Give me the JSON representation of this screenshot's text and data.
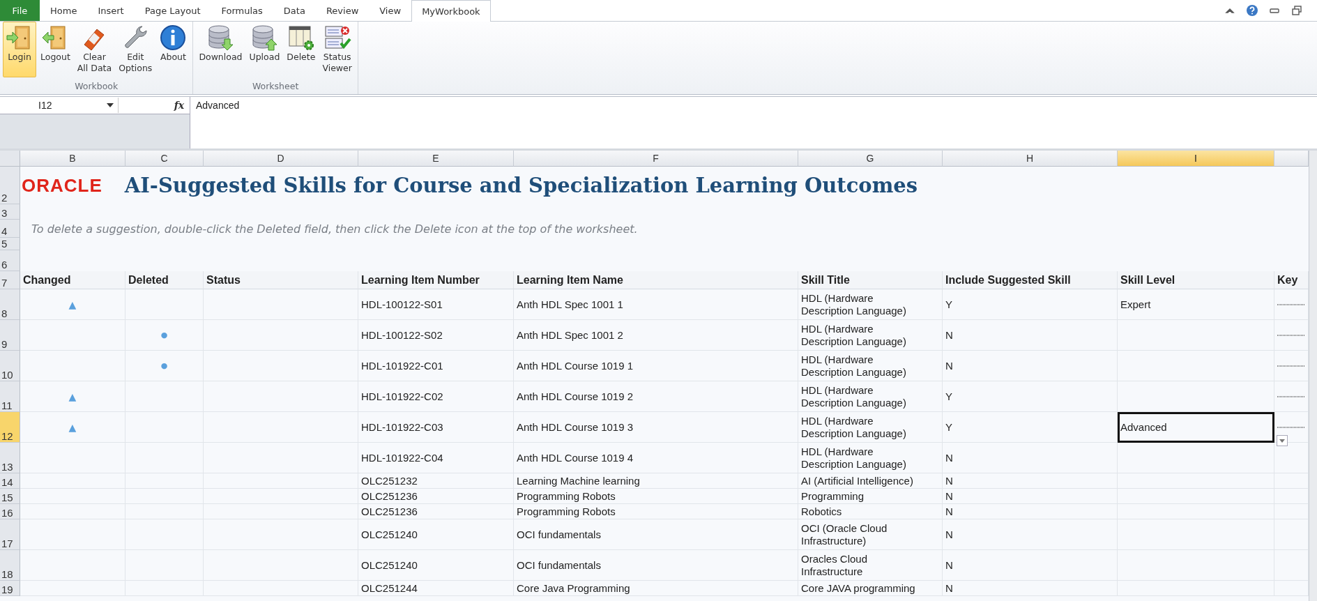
{
  "ribbon_tabs": [
    {
      "label": "File",
      "kind": "file",
      "selected": false
    },
    {
      "label": "Home",
      "kind": "tab",
      "selected": false
    },
    {
      "label": "Insert",
      "kind": "tab",
      "selected": false
    },
    {
      "label": "Page Layout",
      "kind": "tab",
      "selected": false
    },
    {
      "label": "Formulas",
      "kind": "tab",
      "selected": false
    },
    {
      "label": "Data",
      "kind": "tab",
      "selected": false
    },
    {
      "label": "Review",
      "kind": "tab",
      "selected": false
    },
    {
      "label": "View",
      "kind": "tab",
      "selected": false
    },
    {
      "label": "MyWorkbook",
      "kind": "tab",
      "selected": true
    }
  ],
  "ribbon_groups": [
    {
      "label": "Workbook",
      "buttons": [
        {
          "label": "Login",
          "selected": true
        },
        {
          "label": "Logout",
          "selected": false
        },
        {
          "label": "Clear\nAll Data",
          "selected": false
        },
        {
          "label": "Edit\nOptions",
          "selected": false
        },
        {
          "label": "About",
          "selected": false
        }
      ]
    },
    {
      "label": "Worksheet",
      "buttons": [
        {
          "label": "Download",
          "selected": false
        },
        {
          "label": "Upload",
          "selected": false
        },
        {
          "label": "Delete",
          "selected": false
        },
        {
          "label": "Status\nViewer",
          "selected": false
        }
      ]
    }
  ],
  "name_box": "I12",
  "function_symbol": "fx",
  "formula": "Advanced",
  "column_headers": [
    {
      "label": "B",
      "selected": false
    },
    {
      "label": "C",
      "selected": false
    },
    {
      "label": "D",
      "selected": false
    },
    {
      "label": "E",
      "selected": false
    },
    {
      "label": "F",
      "selected": false
    },
    {
      "label": "G",
      "selected": false
    },
    {
      "label": "H",
      "selected": false
    },
    {
      "label": "I",
      "selected": true
    }
  ],
  "top_row_numbers": [
    "2",
    "3",
    "4",
    "5",
    "6"
  ],
  "logo": "ORACLE",
  "title": "AI-Suggested Skills for Course and Specialization Learning Outcomes",
  "instruction": "To delete a suggestion, double-click the Deleted field, then click the Delete icon at the top of the worksheet.",
  "header_row": {
    "number": "7",
    "labels": [
      "Changed",
      "Deleted",
      "Status",
      "Learning Item Number",
      "Learning Item Name",
      "Skill Title",
      "Include Suggested Skill",
      "Skill Level",
      "Key"
    ]
  },
  "rows": [
    {
      "number": "8",
      "selected": false,
      "active": false,
      "key_obscured": true,
      "changed": "▲",
      "item_number": "HDL-100122-S01",
      "item_name": "Anth HDL Spec 1001 1",
      "skill_title": "HDL (Hardware\nDescription Language)",
      "include": "Y",
      "skill_level": "Expert"
    },
    {
      "number": "9",
      "selected": false,
      "active": false,
      "key_obscured": true,
      "deleted": "●",
      "item_number": "HDL-100122-S02",
      "item_name": "Anth HDL Spec 1001 2",
      "skill_title": "HDL (Hardware\nDescription Language)",
      "include": "N"
    },
    {
      "number": "10",
      "selected": false,
      "active": false,
      "key_obscured": true,
      "deleted": "●",
      "item_number": "HDL-101922-C01",
      "item_name": "Anth HDL Course 1019 1",
      "skill_title": "HDL (Hardware\nDescription Language)",
      "include": "N"
    },
    {
      "number": "11",
      "selected": false,
      "active": false,
      "key_obscured": true,
      "changed": "▲",
      "item_number": "HDL-101922-C02",
      "item_name": "Anth HDL Course 1019 2",
      "skill_title": "HDL (Hardware\nDescription Language)",
      "include": "Y"
    },
    {
      "number": "12",
      "selected": true,
      "active": true,
      "key_obscured": true,
      "changed": "▲",
      "item_number": "HDL-101922-C03",
      "item_name": "Anth HDL Course 1019 3",
      "skill_title": "HDL (Hardware\nDescription Language)",
      "include": "Y",
      "skill_level": "Advanced"
    },
    {
      "number": "13",
      "selected": false,
      "active": false,
      "key_obscured": false,
      "item_number": "HDL-101922-C04",
      "item_name": "Anth HDL Course 1019 4",
      "skill_title": "HDL (Hardware\nDescription Language)",
      "include": "N"
    },
    {
      "number": "14",
      "selected": false,
      "active": false,
      "key_obscured": false,
      "item_number": "OLC251232",
      "item_name": "Learning Machine learning",
      "skill_title": "AI (Artificial Intelligence)",
      "include": "N"
    },
    {
      "number": "15",
      "selected": false,
      "active": false,
      "key_obscured": false,
      "item_number": "OLC251236",
      "item_name": "Programming Robots",
      "skill_title": "Programming",
      "include": "N"
    },
    {
      "number": "16",
      "selected": false,
      "active": false,
      "key_obscured": false,
      "item_number": "OLC251236",
      "item_name": "Programming Robots",
      "skill_title": "Robotics",
      "include": "N"
    },
    {
      "number": "17",
      "selected": false,
      "active": false,
      "key_obscured": false,
      "item_number": "OLC251240",
      "item_name": "OCI fundamentals",
      "skill_title": "OCI (Oracle Cloud\nInfrastructure)",
      "include": "N"
    },
    {
      "number": "18",
      "selected": false,
      "active": false,
      "key_obscured": false,
      "item_number": "OLC251240",
      "item_name": "OCI fundamentals",
      "skill_title": "Oracles Cloud\nInfrastructure",
      "include": "N"
    },
    {
      "number": "19",
      "selected": false,
      "active": false,
      "key_obscured": false,
      "item_number": "OLC251244",
      "item_name": "Core Java Programming",
      "skill_title": "Core JAVA programming",
      "include": "N"
    }
  ]
}
